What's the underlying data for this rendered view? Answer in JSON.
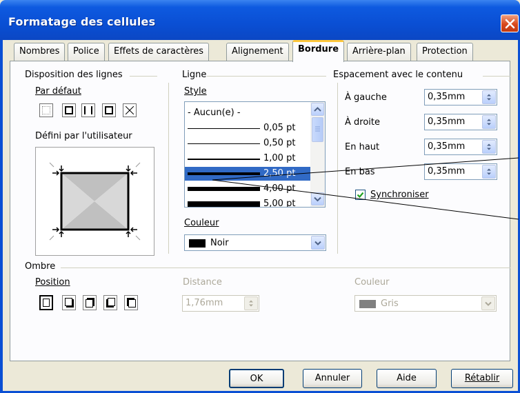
{
  "window": {
    "title": "Formatage des cellules"
  },
  "tabs": [
    "Nombres",
    "Police",
    "Effets de caractères",
    "Alignement",
    "Bordure",
    "Arrière-plan",
    "Protection"
  ],
  "active_tab": "Bordure",
  "line_arrangement": {
    "section_label": "Disposition des lignes",
    "default_label": "Par défaut",
    "user_defined_label": "Défini par l'utilisateur"
  },
  "line": {
    "section_label": "Ligne",
    "style_label": "Style",
    "style_none": "- Aucun(e) -",
    "styles": [
      "0,05 pt",
      "0,50 pt",
      "1,00 pt",
      "2,50 pt",
      "4,00 pt",
      "5,00 pt"
    ],
    "selected_style": "2,50 pt",
    "color_label": "Couleur",
    "color_value": "Noir",
    "color_swatch": "#000000"
  },
  "spacing": {
    "section_label": "Espacement avec le contenu",
    "left_label": "À gauche",
    "left_value": "0,35mm",
    "right_label": "À droite",
    "right_value": "0,35mm",
    "top_label": "En haut",
    "top_value": "0,35mm",
    "bottom_label": "En bas",
    "bottom_value": "0,35mm",
    "sync_label": "Synchroniser",
    "sync_checked": true
  },
  "shadow": {
    "section_label": "Ombre",
    "position_label": "Position",
    "distance_label": "Distance",
    "distance_value": "1,76mm",
    "color_label": "Couleur",
    "color_value": "Gris",
    "color_swatch": "#808080"
  },
  "buttons": {
    "ok": "OK",
    "cancel": "Annuler",
    "help": "Aide",
    "reset": "Rétablir"
  },
  "colors": {
    "titlebar": "#0a4fd4",
    "selection": "#316ac5",
    "active_tab_accent": "#ffc83c"
  }
}
